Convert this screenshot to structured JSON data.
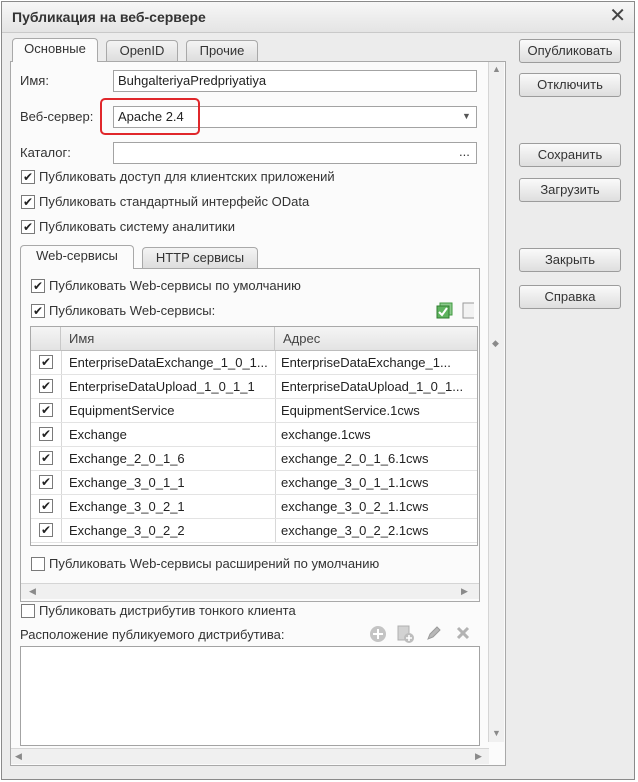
{
  "window": {
    "title": "Публикация на веб-сервере"
  },
  "main_tabs": [
    {
      "label": "Основные"
    },
    {
      "label": "OpenID"
    },
    {
      "label": "Прочие"
    }
  ],
  "form": {
    "name_label": "Имя:",
    "name_value": "BuhgalteriyaPredpriyatiya",
    "server_label": "Веб-сервер:",
    "server_value": "Apache 2.4",
    "catalog_label": "Каталог:",
    "catalog_value": "",
    "browse_label": "...",
    "publish_clients": "Публиковать доступ для клиентских приложений",
    "publish_odata": "Публиковать стандартный интерфейс OData",
    "publish_analytics": "Публиковать систему аналитики"
  },
  "sub_tabs": [
    {
      "label": "Web-сервисы"
    },
    {
      "label": "HTTP сервисы"
    }
  ],
  "services": {
    "publish_default": "Публиковать Web-сервисы по умолчанию",
    "publish_ws": "Публиковать Web-сервисы:",
    "col_name": "Имя",
    "col_address": "Адрес",
    "rows": [
      {
        "name": "EnterpriseDataExchange_1_0_1...",
        "address": "EnterpriseDataExchange_1..."
      },
      {
        "name": "EnterpriseDataUpload_1_0_1_1",
        "address": "EnterpriseDataUpload_1_0_1..."
      },
      {
        "name": "EquipmentService",
        "address": "EquipmentService.1cws"
      },
      {
        "name": "Exchange",
        "address": "exchange.1cws"
      },
      {
        "name": "Exchange_2_0_1_6",
        "address": "exchange_2_0_1_6.1cws"
      },
      {
        "name": "Exchange_3_0_1_1",
        "address": "exchange_3_0_1_1.1cws"
      },
      {
        "name": "Exchange_3_0_2_1",
        "address": "exchange_3_0_2_1.1cws"
      },
      {
        "name": "Exchange_3_0_2_2",
        "address": "exchange_3_0_2_2.1cws"
      }
    ],
    "publish_ext": "Публиковать Web-сервисы расширений по умолчанию"
  },
  "distrib": {
    "publish_thin": "Публиковать дистрибутив тонкого клиента",
    "location_label": "Расположение публикуемого дистрибутива:"
  },
  "buttons": {
    "publish": "Опубликовать",
    "disable": "Отключить",
    "save": "Сохранить",
    "load": "Загрузить",
    "close": "Закрыть",
    "help": "Справка"
  },
  "glyphs": {
    "check": "✔",
    "close": "✕",
    "dropdown": "▼"
  },
  "colors": {
    "highlight": "#e0272b",
    "icon_green": "#3f9a3f",
    "icon_gray": "#b5b5b5"
  }
}
